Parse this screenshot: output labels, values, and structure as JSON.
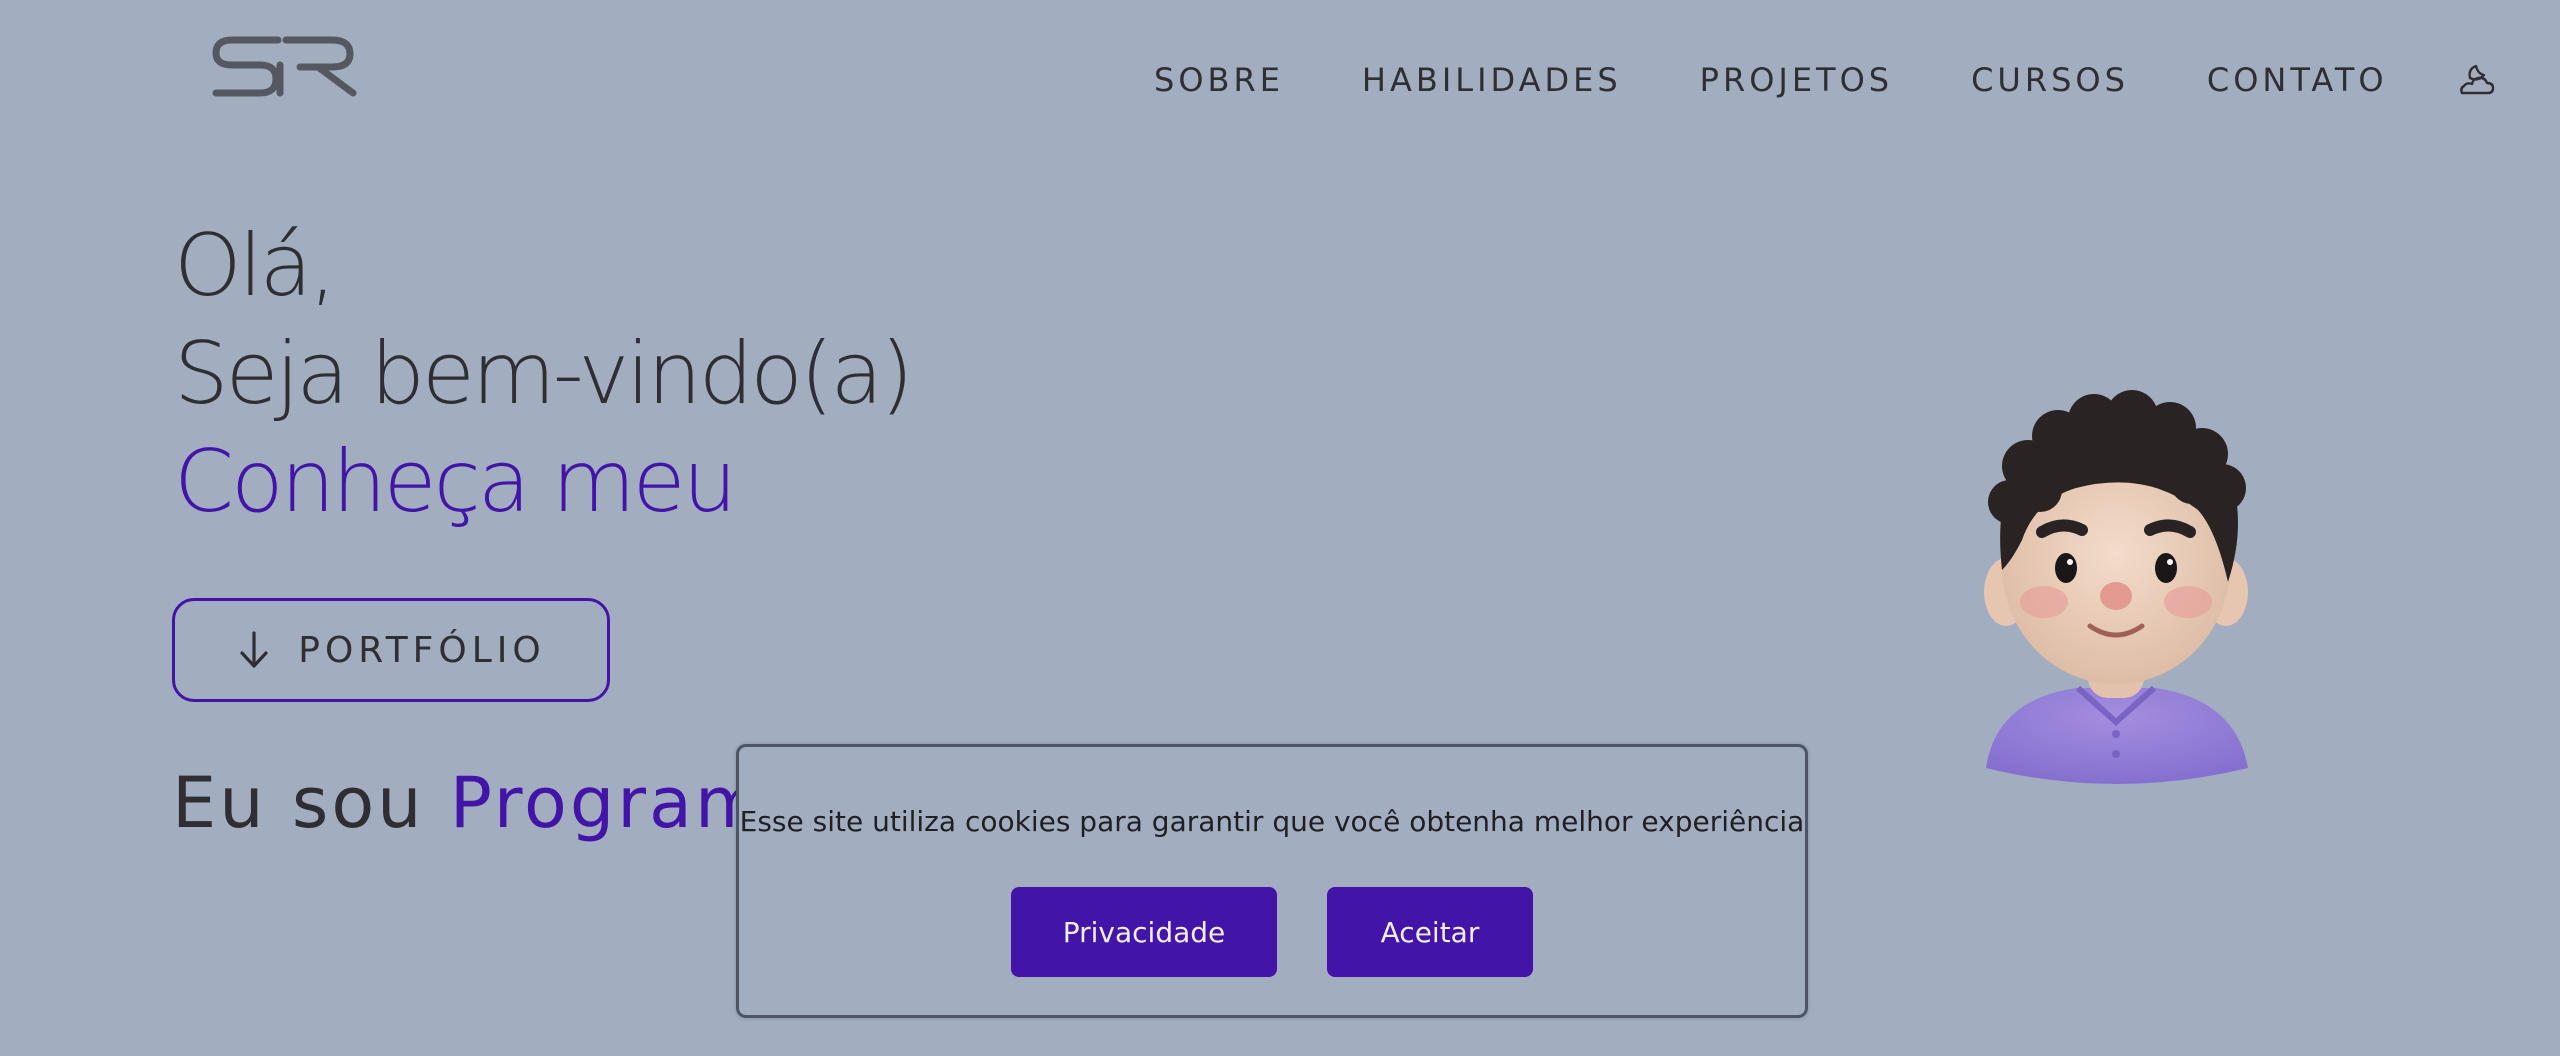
{
  "header": {
    "logo_text": "SR",
    "nav": [
      {
        "label": "SOBRE"
      },
      {
        "label": "HABILIDADES"
      },
      {
        "label": "PROJETOS"
      },
      {
        "label": "CURSOS"
      },
      {
        "label": "CONTATO"
      }
    ],
    "theme_icon": "moon-cloud-icon"
  },
  "hero": {
    "line1": "Olá,",
    "line2": "Seja bem-vindo(a)",
    "line3": "Conheça meu",
    "portfolio_button": "PORTFÓLIO",
    "portfolio_icon": "arrow-down-icon",
    "intro_prefix": "Eu sou",
    "intro_accent": "Program"
  },
  "avatar": {
    "icon": "avatar-icon"
  },
  "cookie_banner": {
    "text": "Esse site utiliza cookies para garantir que você obtenha melhor experiência",
    "privacy_button": "Privacidade",
    "accept_button": "Aceitar"
  },
  "colors": {
    "background": "#a2aec0",
    "accent": "#4314a8",
    "text": "#2f2f33"
  }
}
